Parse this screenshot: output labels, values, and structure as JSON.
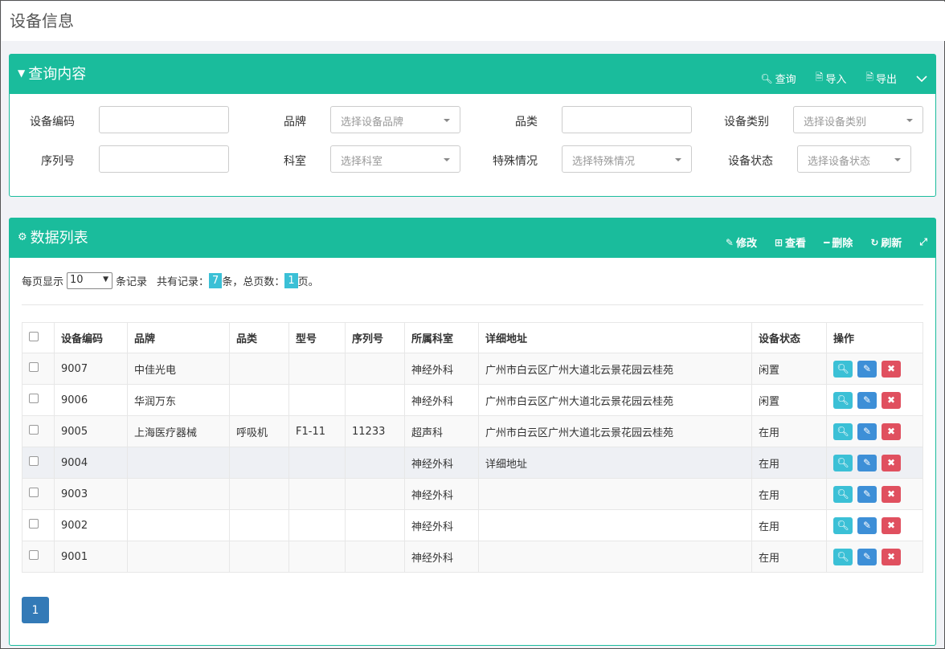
{
  "page": {
    "title": "设备信息"
  },
  "query_panel": {
    "title": "查询内容",
    "tools": {
      "search": "查询",
      "import": "导入",
      "export": "导出"
    },
    "fields": {
      "code_label": "设备编码",
      "brand_label": "品牌",
      "brand_placeholder": "选择设备品牌",
      "category_label": "品类",
      "type_label": "设备类别",
      "type_placeholder": "选择设备类别",
      "serial_label": "序列号",
      "dept_label": "科室",
      "dept_placeholder": "选择科室",
      "special_label": "特殊情况",
      "special_placeholder": "选择特殊情况",
      "status_label": "设备状态",
      "status_placeholder": "选择设备状态"
    }
  },
  "list_panel": {
    "title": "数据列表",
    "tools": {
      "edit": "修改",
      "view": "查看",
      "delete": "删除",
      "refresh": "刷新"
    },
    "pager": {
      "prefix": "每页显示",
      "page_size": "10",
      "suffix": "条记录",
      "total_prefix": "共有记录：",
      "total": "7",
      "total_suffix": "条，总页数：",
      "pages": "1",
      "pages_suffix": "页。"
    },
    "columns": [
      "设备编码",
      "品牌",
      "品类",
      "型号",
      "序列号",
      "所属科室",
      "详细地址",
      "设备状态",
      "操作"
    ],
    "rows": [
      [
        "9007",
        "中佳光电",
        "",
        "",
        "",
        "神经外科",
        "广州市白云区广州大道北云景花园云桂苑",
        "闲置"
      ],
      [
        "9006",
        "华润万东",
        "",
        "",
        "",
        "神经外科",
        "广州市白云区广州大道北云景花园云桂苑",
        "闲置"
      ],
      [
        "9005",
        "上海医疗器械",
        "呼吸机",
        "F1-11",
        "11233",
        "超声科",
        "广州市白云区广州大道北云景花园云桂苑",
        "在用"
      ],
      [
        "9004",
        "",
        "",
        "",
        "",
        "神经外科",
        "详细地址",
        "在用"
      ],
      [
        "9003",
        "",
        "",
        "",
        "",
        "神经外科",
        "",
        "在用"
      ],
      [
        "9002",
        "",
        "",
        "",
        "",
        "神经外科",
        "",
        "在用"
      ],
      [
        "9001",
        "",
        "",
        "",
        "",
        "神经外科",
        "",
        "在用"
      ]
    ],
    "current_page": "1"
  }
}
